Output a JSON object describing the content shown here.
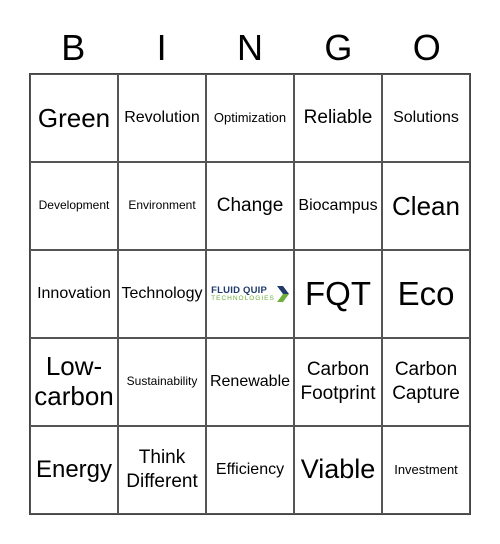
{
  "header": {
    "letters": [
      "B",
      "I",
      "N",
      "G",
      "O"
    ]
  },
  "card": {
    "rows": [
      [
        "Green",
        "Revolution",
        "Optimization",
        "Reliable",
        "Solutions"
      ],
      [
        "Development",
        "Environment",
        "Change",
        "Biocampus",
        "Clean"
      ],
      [
        "Innovation",
        "Technology",
        "FREE_LOGO",
        "FQT",
        "Eco"
      ],
      [
        "Low-carbon",
        "Sustainability",
        "Renewable",
        "Carbon Footprint",
        "Carbon Capture"
      ],
      [
        "Energy",
        "Think Different",
        "Efficiency",
        "Viable",
        "Investment"
      ]
    ],
    "free_space": {
      "line1": "FLUID QUIP",
      "line2": "TECHNOLOGIES",
      "icon": "chevron-right-icon",
      "colors": {
        "primary": "#1f3a6b",
        "accent": "#6fae3c"
      }
    }
  }
}
